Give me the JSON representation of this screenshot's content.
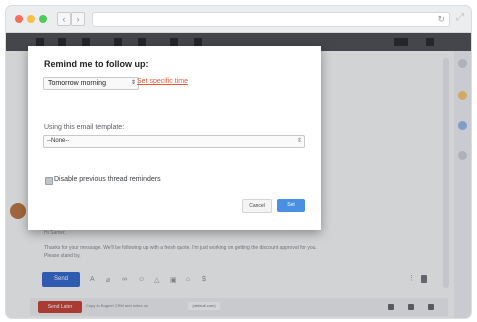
{
  "browser": {
    "back_glyph": "‹",
    "forward_glyph": "›",
    "reload_glyph": "↻",
    "expand_glyph": "⤢"
  },
  "modal": {
    "title": "Remind me to follow up:",
    "time_option": "Tomorrow morning",
    "set_specific_time": "Set specific time",
    "template_label": "Using this email template:",
    "template_option": "--None--",
    "disable_label": "Disable previous thread reminders",
    "cancel_label": "Cancel",
    "set_label": "Set"
  },
  "reply": {
    "greeting": "Hi Samer,",
    "line1": "Thanks for your message. We'll be following up with a fresh quote. I'm just working on getting the discount approval for you.",
    "line2": "Please stand by.",
    "send_label": "Send"
  },
  "bottom_bar": {
    "send_later_label": "Send Later",
    "text": "Copy to Bugnet CRM and notes on",
    "chip": "(default.com)"
  },
  "colors": {
    "send_button": "#2c63c9",
    "set_button": "#4a90e2",
    "link": "#e55a3b",
    "send_later": "#c13b2f"
  }
}
